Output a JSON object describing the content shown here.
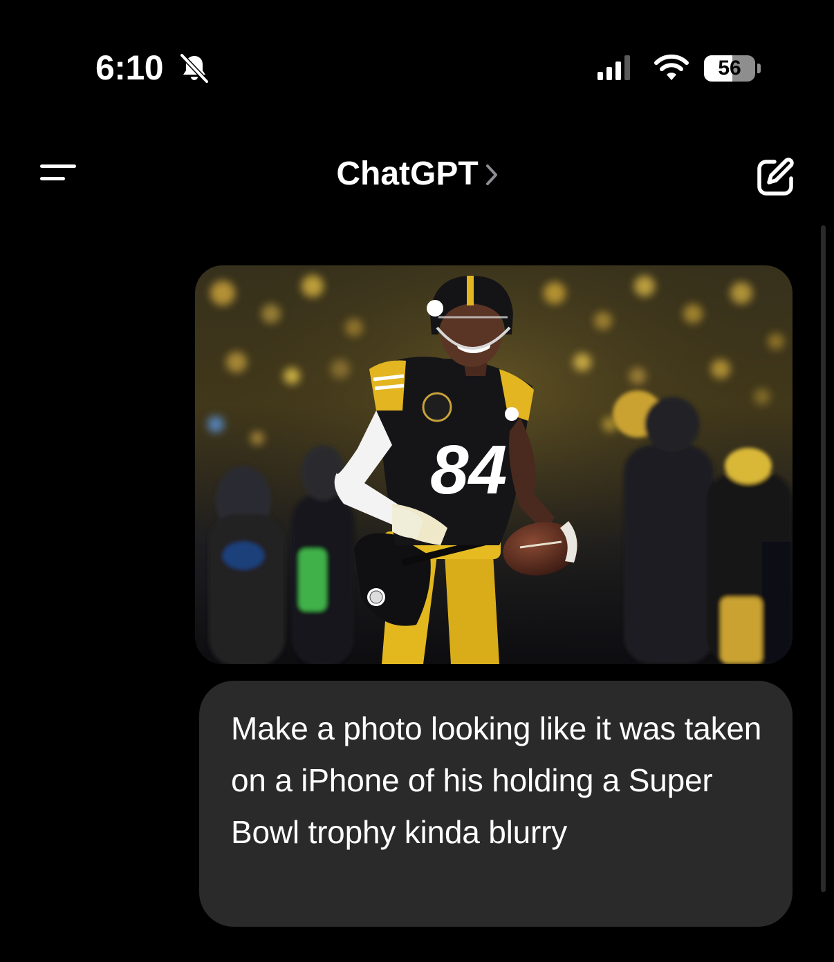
{
  "status_bar": {
    "time": "6:10",
    "battery_level": "56",
    "battery_fraction": 0.56,
    "icons": [
      "bell-slash-icon",
      "cellular-signal-icon",
      "wifi-icon",
      "battery-icon"
    ]
  },
  "nav": {
    "title": "ChatGPT",
    "icons": [
      "menu-icon",
      "chevron-right-icon",
      "new-chat-icon"
    ]
  },
  "chat": {
    "attachment": {
      "kind": "photo",
      "jersey_number": "84"
    },
    "user_message": "Make a photo looking like it was taken on a iPhone of his holding a Super Bowl trophy kinda blurry"
  },
  "colors": {
    "background": "#000000",
    "bubble": "#2a2a2a",
    "text": "#ffffff",
    "team_gold": "#f2c21b",
    "team_black": "#111111"
  }
}
